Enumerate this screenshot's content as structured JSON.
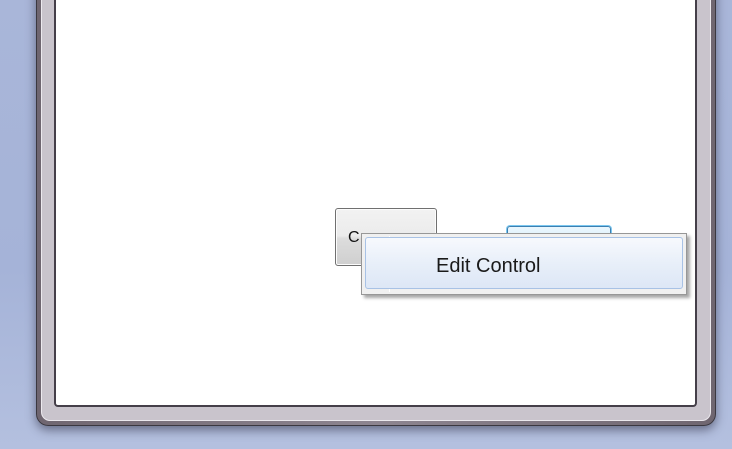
{
  "dialog": {
    "cancel_label": "C",
    "ok_label": ""
  },
  "context_menu": {
    "items": [
      {
        "label": "Edit Control"
      }
    ]
  },
  "colors": {
    "desktop": "#a9b6d9",
    "frame": "#7a717d",
    "client": "#ffffff",
    "menu_highlight": "#dde7f6",
    "ok_button_glow": "#7cc8f0"
  }
}
